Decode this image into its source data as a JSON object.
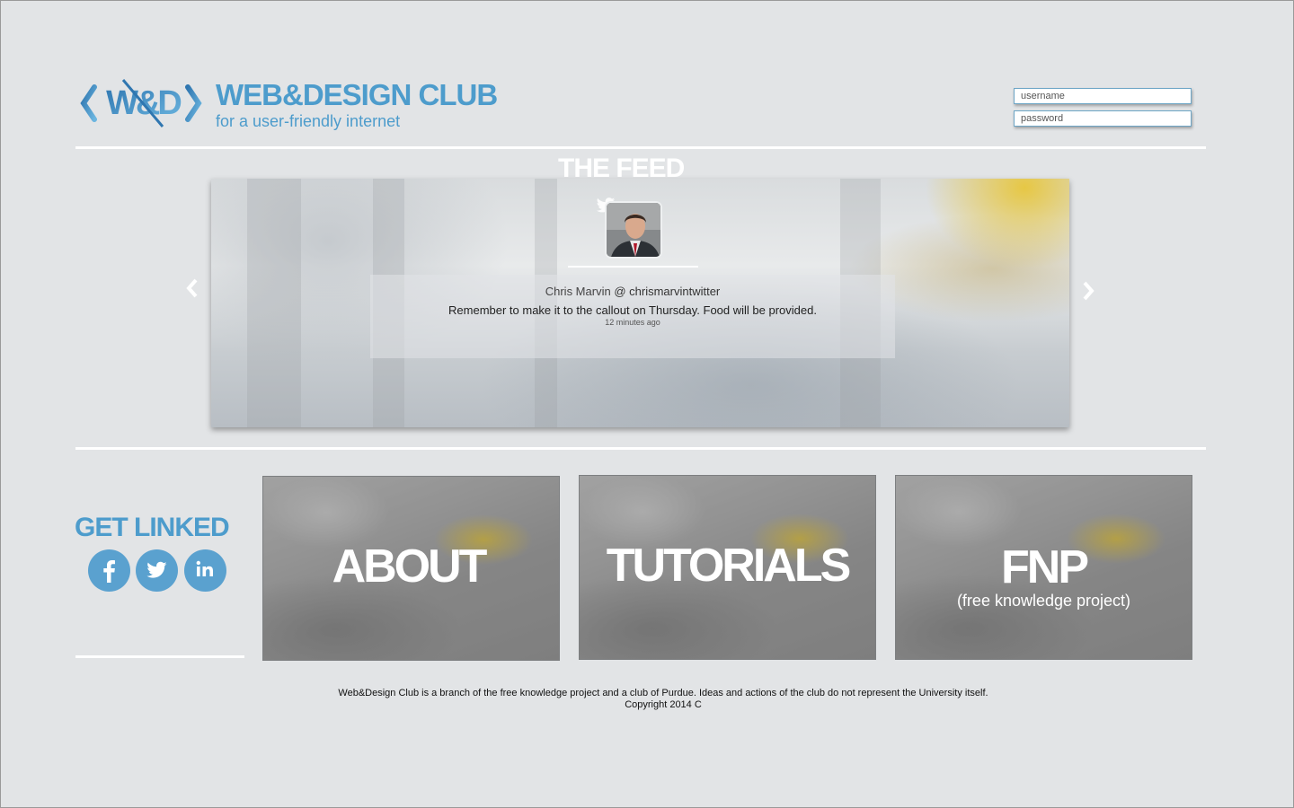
{
  "header": {
    "site_name": "WEB&DESIGN CLUB",
    "tagline": "for a user-friendly internet",
    "logo": {
      "text": "W&D",
      "icon": "wd-logo-icon"
    }
  },
  "login": {
    "username_placeholder": "username",
    "password_placeholder": "password"
  },
  "feed": {
    "title": "THE FEED",
    "tweet": {
      "author": "Chris Marvin",
      "handle": "@ chrismarvintwitter",
      "text": "Remember to make it to the callout on Thursday. Food will be provided.",
      "time": "12 minutes ago"
    },
    "icons": {
      "source": "twitter-icon",
      "prev": "chevron-left-icon",
      "next": "chevron-right-icon"
    }
  },
  "social": {
    "title": "GET LINKED",
    "items": [
      "facebook-icon",
      "twitter-icon",
      "linkedin-icon"
    ]
  },
  "tiles": [
    {
      "title": "ABOUT",
      "subtitle": ""
    },
    {
      "title": "TUTORIALS",
      "subtitle": ""
    },
    {
      "title": "FNP",
      "subtitle": "(free knowledge project)"
    }
  ],
  "footer": {
    "line1": "Web&Design Club is a branch of the free knowledge project and a club of Purdue. Ideas and actions of the club do not represent the University itself.",
    "line2": "Copyright 2014 C"
  },
  "colors": {
    "accent": "#4d9ccc",
    "social": "#5aa1cf",
    "background": "#e2e4e6"
  }
}
